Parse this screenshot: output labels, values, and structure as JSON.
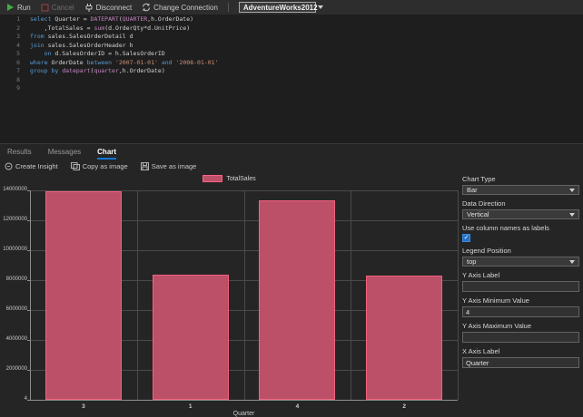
{
  "toolbar": {
    "run": "Run",
    "cancel": "Cancel",
    "disconnect": "Disconnect",
    "change_connection": "Change Connection",
    "database": "AdventureWorks2012"
  },
  "editor": {
    "lines": [
      {
        "num": "1",
        "parts": [
          {
            "t": "kw",
            "v": "select"
          },
          {
            "t": "txt",
            "v": " Quarter = "
          },
          {
            "t": "fn",
            "v": "DATEPART"
          },
          {
            "t": "txt",
            "v": "("
          },
          {
            "t": "fn",
            "v": "QUARTER"
          },
          {
            "t": "txt",
            "v": ",h.OrderDate)"
          }
        ]
      },
      {
        "num": "2",
        "parts": [
          {
            "t": "txt",
            "v": "    ,TotalSales = "
          },
          {
            "t": "fn",
            "v": "sum"
          },
          {
            "t": "txt",
            "v": "(d.OrderQty*d.UnitPrice)"
          }
        ]
      },
      {
        "num": "3",
        "parts": [
          {
            "t": "kw",
            "v": "from"
          },
          {
            "t": "txt",
            "v": " sales.SalesOrderDetail d"
          }
        ]
      },
      {
        "num": "4",
        "parts": [
          {
            "t": "kw",
            "v": "join"
          },
          {
            "t": "txt",
            "v": " sales.SalesOrderHeader h"
          }
        ]
      },
      {
        "num": "5",
        "parts": [
          {
            "t": "txt",
            "v": "    "
          },
          {
            "t": "kw",
            "v": "on"
          },
          {
            "t": "txt",
            "v": " d.SalesOrderID = h.SalesOrderID"
          }
        ]
      },
      {
        "num": "6",
        "parts": [
          {
            "t": "kw",
            "v": "where"
          },
          {
            "t": "txt",
            "v": " OrderDate "
          },
          {
            "t": "kw",
            "v": "between"
          },
          {
            "t": "txt",
            "v": " "
          },
          {
            "t": "str",
            "v": "'2007-01-01'"
          },
          {
            "t": "txt",
            "v": " "
          },
          {
            "t": "kw",
            "v": "and"
          },
          {
            "t": "txt",
            "v": " "
          },
          {
            "t": "str",
            "v": "'2008-01-01'"
          }
        ]
      },
      {
        "num": "7",
        "parts": [
          {
            "t": "kw",
            "v": "group by"
          },
          {
            "t": "txt",
            "v": " "
          },
          {
            "t": "fn",
            "v": "datepart"
          },
          {
            "t": "txt",
            "v": "("
          },
          {
            "t": "fn",
            "v": "quarter"
          },
          {
            "t": "txt",
            "v": ",h.OrderDate)"
          }
        ]
      },
      {
        "num": "8",
        "parts": []
      },
      {
        "num": "9",
        "parts": []
      }
    ]
  },
  "results": {
    "tabs": [
      {
        "label": "Results",
        "active": false
      },
      {
        "label": "Messages",
        "active": false
      },
      {
        "label": "Chart",
        "active": true
      }
    ],
    "actions": [
      {
        "label": "Create Insight"
      },
      {
        "label": "Copy as image"
      },
      {
        "label": "Save as image"
      }
    ]
  },
  "chart_data": {
    "type": "bar",
    "categories": [
      "3",
      "1",
      "4",
      "2"
    ],
    "series": [
      {
        "name": "TotalSales",
        "values": [
          13950000,
          8350000,
          13330000,
          8330000
        ]
      }
    ],
    "xlabel": "Quarter",
    "ylabel": "",
    "ylim": [
      4,
      14000000
    ],
    "yticks": [
      "14000000",
      "12000000",
      "10000000",
      "8000000",
      "6000000",
      "4000000",
      "2000000",
      "4"
    ],
    "legend_position": "top",
    "grid": true,
    "bar_fill": "#bb5068",
    "bar_border": "#ff6384"
  },
  "options_panel": {
    "fields": [
      {
        "label": "Chart Type",
        "type": "select",
        "value": "Bar"
      },
      {
        "label": "Data Direction",
        "type": "select",
        "value": "Vertical"
      },
      {
        "label": "Use column names as labels",
        "type": "checkbox",
        "checked": true
      },
      {
        "label": "Legend Position",
        "type": "select",
        "value": "top"
      },
      {
        "label": "Y Axis Label",
        "type": "input",
        "value": ""
      },
      {
        "label": "Y Axis Minimum Value",
        "type": "input",
        "value": "4"
      },
      {
        "label": "Y Axis Maximum Value",
        "type": "input",
        "value": ""
      },
      {
        "label": "X Axis Label",
        "type": "input",
        "value": "Quarter"
      }
    ]
  },
  "colors": {
    "accent_blue": "#1177d4",
    "run_green": "#3fae3f",
    "bar_fill": "#bb5068",
    "bar_border": "#ff6384",
    "keyword": "#569cd6",
    "function": "#c586c0",
    "string": "#ce9178"
  }
}
